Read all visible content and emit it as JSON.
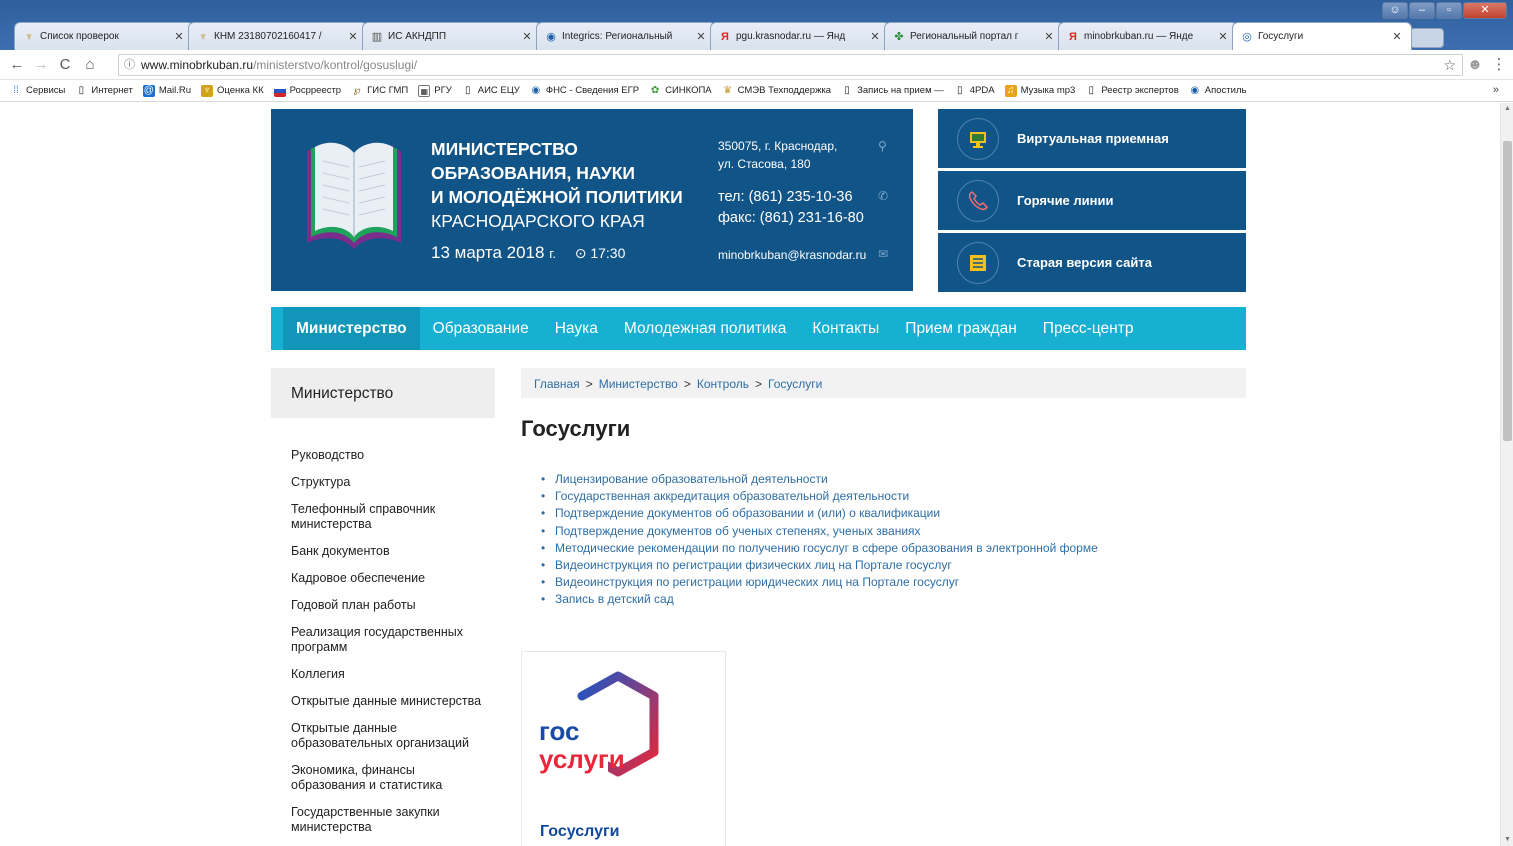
{
  "browser": {
    "tabs": [
      {
        "title": "Список проверок",
        "icon": "emblem-icon"
      },
      {
        "title": "КНМ 23180702160417 /",
        "icon": "emblem-icon"
      },
      {
        "title": "ИС АКНДПП",
        "icon": "building-icon"
      },
      {
        "title": "Integrics: Региональный",
        "icon": "integrics-icon"
      },
      {
        "title": "pgu.krasnodar.ru — Янд",
        "icon": "yandex-icon"
      },
      {
        "title": "Региональный портал г",
        "icon": "portal-icon"
      },
      {
        "title": "minobrkuban.ru — Янде",
        "icon": "yandex-icon"
      },
      {
        "title": "Госуслуги",
        "icon": "page-icon"
      }
    ],
    "url_host": "www.minobrkuban.ru",
    "url_path": "/ministerstvo/kontrol/gosuslugi/",
    "bookmarks": [
      "Сервисы",
      "Интернет",
      "Mail.Ru",
      "Оценка КК",
      "Росрреестр",
      "ГИС ГМП",
      "РГУ",
      "АИС ЕЦУ",
      "ФНС - Сведения ЕГР",
      "СИНКОПА",
      "СМЭВ Техподдержка",
      "Запись на прием —",
      "4PDA",
      "Музыка mp3",
      "Реестр экспертов",
      "Апостиль"
    ],
    "bookmarks_more": "»"
  },
  "header": {
    "name_lines": [
      "МИНИСТЕРСТВО",
      "ОБРАЗОВАНИЯ, НАУКИ",
      "И МОЛОДЁЖНОЙ ПОЛИТИКИ"
    ],
    "region": "КРАСНОДАРСКОГО КРАЯ",
    "date": "13 марта 2018",
    "year_suffix": "г.",
    "time": "⊙ 17:30",
    "address_line1": "350075, г. Краснодар,",
    "address_line2": "ул. Стасова, 180",
    "phone": "тел: (861) 235-10-36",
    "fax": "факс: (861) 231-16-80",
    "email": "minobrkuban@krasnodar.ru"
  },
  "quick_links": [
    {
      "label": "Виртуальная приемная",
      "icon": "monitor-icon"
    },
    {
      "label": "Горячие линии",
      "icon": "phone-icon"
    },
    {
      "label": "Старая версия сайта",
      "icon": "newspaper-icon"
    }
  ],
  "nav": [
    "Министерство",
    "Образование",
    "Наука",
    "Молодежная политика",
    "Контакты",
    "Прием граждан",
    "Пресс-центр"
  ],
  "sidebar": {
    "title": "Министерство",
    "items": [
      "Руководство",
      "Структура",
      "Телефонный справочник министерства",
      "Банк документов",
      "Кадровое обеспечение",
      "Годовой план работы",
      "Реализация государственных программ",
      "Коллегия",
      "Открытые данные министерства",
      "Открытые данные образовательных организаций",
      "Экономика, финансы образования и статистика",
      "Государственные закупки министерства"
    ]
  },
  "breadcrumbs": [
    "Главная",
    "Министерство",
    "Контроль",
    "Госуслуги"
  ],
  "breadcrumb_sep": ">",
  "page_title": "Госуслуги",
  "links": [
    "Лицензирование образовательной деятельности",
    "Государственная аккредитация образовательной деятельности",
    "Подтверждение документов об образовании и (или) о квалификации",
    "Подтверждение документов об ученых степенях, ученых званиях",
    "Методические рекомендации по получению госуслуг в сфере образования в электронной форме",
    "Видеоинструкция по регистрации физических лиц на Портале госуслуг",
    "Видеоинструкция по регистрации юридических лиц на Портале госуслуг",
    "Запись в детский сад"
  ],
  "gosuslugi_banner": {
    "logo_line1": "гос",
    "logo_line2": "услуги",
    "caption": "Госуслуги"
  },
  "colors": {
    "header_blue": "#115487",
    "nav_cyan": "#17b0d2",
    "link_blue": "#2e6ea6"
  }
}
